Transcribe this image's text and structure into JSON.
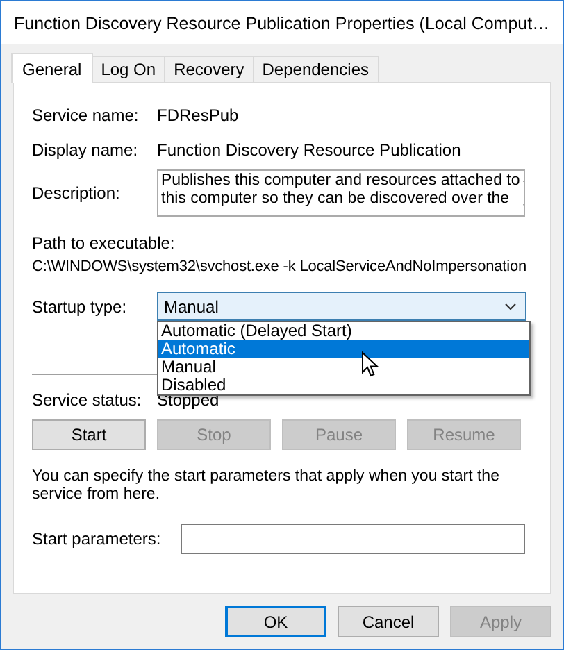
{
  "window": {
    "title": "Function Discovery Resource Publication Properties (Local Comput…"
  },
  "tabs": [
    {
      "label": "General",
      "selected": true
    },
    {
      "label": "Log On",
      "selected": false
    },
    {
      "label": "Recovery",
      "selected": false
    },
    {
      "label": "Dependencies",
      "selected": false
    }
  ],
  "service_name": {
    "label": "Service name:",
    "value": "FDResPub"
  },
  "display_name": {
    "label": "Display name:",
    "value": "Function Discovery Resource Publication"
  },
  "description": {
    "label": "Description:",
    "lines": [
      "Publishes this computer and resources attached to",
      "this computer so they can be discovered over the"
    ]
  },
  "path": {
    "label": "Path to executable:",
    "value": "C:\\WINDOWS\\system32\\svchost.exe -k LocalServiceAndNoImpersonation"
  },
  "startup_type": {
    "label": "Startup type:",
    "value": "Manual",
    "expanded": true,
    "options": [
      {
        "label": "Automatic (Delayed Start)",
        "highlighted": false
      },
      {
        "label": "Automatic",
        "highlighted": true
      },
      {
        "label": "Manual",
        "highlighted": false
      },
      {
        "label": "Disabled",
        "highlighted": false
      }
    ]
  },
  "service_status": {
    "label": "Service status:",
    "value": "Stopped"
  },
  "service_buttons": [
    {
      "label": "Start",
      "disabled": false
    },
    {
      "label": "Stop",
      "disabled": true
    },
    {
      "label": "Pause",
      "disabled": true
    },
    {
      "label": "Resume",
      "disabled": true
    }
  ],
  "hint": "You can specify the start parameters that apply when you start the service from here.",
  "start_parameters": {
    "label": "Start parameters:"
  },
  "dialog_buttons": [
    {
      "label": "OK",
      "default": true,
      "disabled": false
    },
    {
      "label": "Cancel",
      "default": false,
      "disabled": false
    },
    {
      "label": "Apply",
      "default": false,
      "disabled": true
    }
  ]
}
